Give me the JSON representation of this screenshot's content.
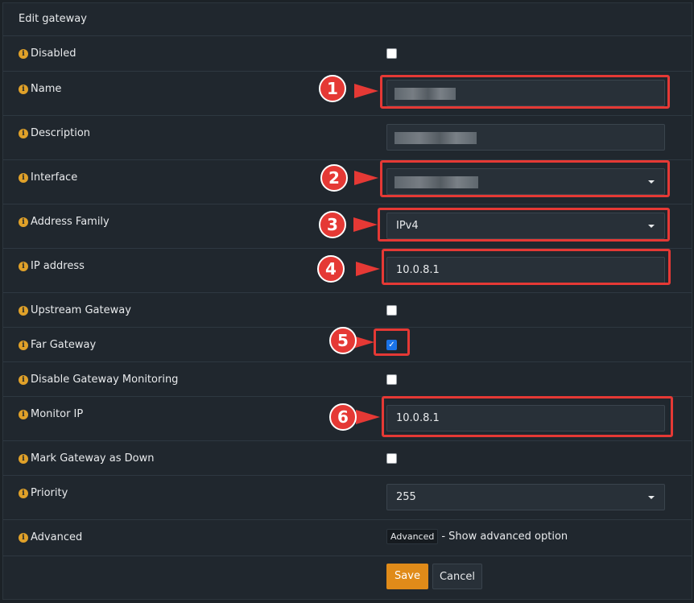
{
  "panel": {
    "title": "Edit gateway"
  },
  "fields": {
    "disabled": {
      "label": "Disabled",
      "checked": false
    },
    "name": {
      "label": "Name",
      "value": ""
    },
    "description": {
      "label": "Description",
      "value": ""
    },
    "interface": {
      "label": "Interface",
      "value": ""
    },
    "address_family": {
      "label": "Address Family",
      "value": "IPv4"
    },
    "ip_address": {
      "label": "IP address",
      "value": "10.0.8.1"
    },
    "upstream_gateway": {
      "label": "Upstream Gateway",
      "checked": false
    },
    "far_gateway": {
      "label": "Far Gateway",
      "checked": true
    },
    "disable_monitoring": {
      "label": "Disable Gateway Monitoring",
      "checked": false
    },
    "monitor_ip": {
      "label": "Monitor IP",
      "value": "10.0.8.1"
    },
    "mark_down": {
      "label": "Mark Gateway as Down",
      "checked": false
    },
    "priority": {
      "label": "Priority",
      "value": "255"
    },
    "advanced": {
      "label": "Advanced",
      "button": "Advanced",
      "hint": "- Show advanced option"
    }
  },
  "actions": {
    "save": "Save",
    "cancel": "Cancel"
  },
  "callouts": [
    "1",
    "2",
    "3",
    "4",
    "5",
    "6"
  ],
  "colors": {
    "accent": "#e08b19",
    "highlight": "#e53935",
    "info": "#e0a129",
    "checkbox_checked": "#1a73e8"
  },
  "icons": {
    "info": "info-circle-icon",
    "dropdown": "chevron-down-icon"
  }
}
